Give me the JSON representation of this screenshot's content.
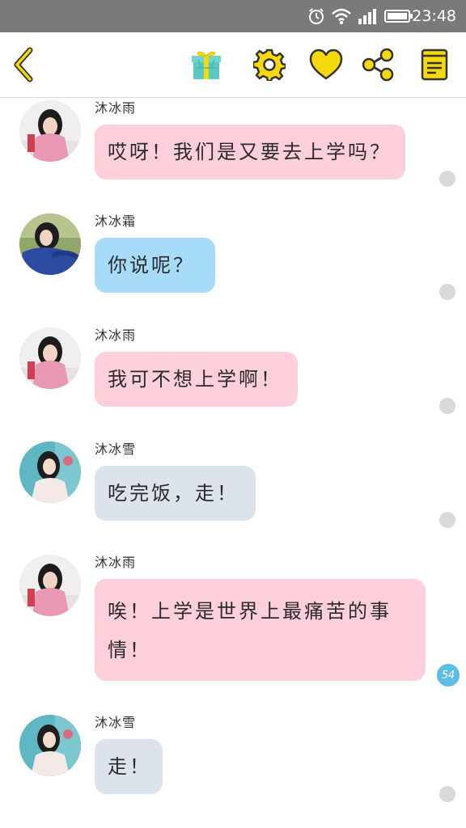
{
  "status_bar": {
    "time": "23:48",
    "icons": [
      "alarm-icon",
      "wifi-icon",
      "signal-icon",
      "battery-icon"
    ]
  },
  "toolbar": {
    "icons": [
      "back-icon",
      "gift-icon",
      "settings-icon",
      "heart-icon",
      "share-icon",
      "notes-icon"
    ],
    "colors": {
      "accent": "#f5d90a",
      "stroke": "#333333",
      "gift": "#5cc9c1"
    }
  },
  "messages": [
    {
      "sender": "沐冰雨",
      "text": "哎呀！我们是又要去上学吗？",
      "bubble_color": "#fccfda",
      "avatar": "girl-pink-sweater"
    },
    {
      "sender": "沐冰霜",
      "text": "你说呢？",
      "bubble_color": "#a7dcf9",
      "avatar": "girl-blue-jacket"
    },
    {
      "sender": "沐冰雨",
      "text": "我可不想上学啊！",
      "bubble_color": "#fccfda",
      "avatar": "girl-pink-sweater"
    },
    {
      "sender": "沐冰雪",
      "text": "吃完饭，走！",
      "bubble_color": "#dde3ea",
      "avatar": "girl-teal-background"
    },
    {
      "sender": "沐冰雨",
      "text": "唉！上学是世界上最痛苦的事情！",
      "bubble_color": "#fccfda",
      "avatar": "girl-pink-sweater",
      "badge": "54"
    },
    {
      "sender": "沐冰雪",
      "text": "走！",
      "bubble_color": "#dde3ea",
      "avatar": "girl-teal-background"
    }
  ]
}
